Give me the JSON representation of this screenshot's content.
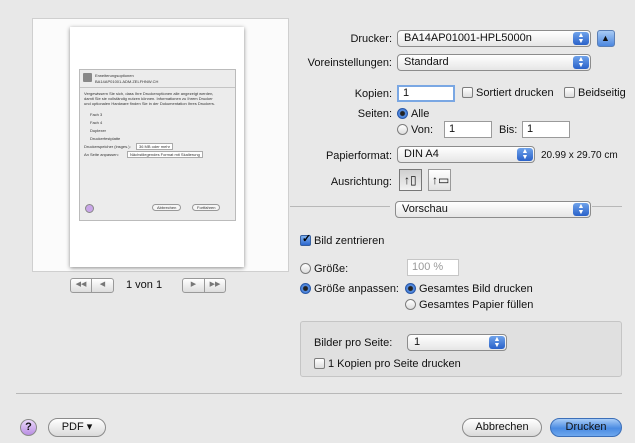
{
  "printer": {
    "label": "Drucker:",
    "value": "BA14AP01001-HPL5000n"
  },
  "presets": {
    "label": "Voreinstellungen:",
    "value": "Standard"
  },
  "copies": {
    "label": "Kopien:",
    "value": "1",
    "collated": "Sortiert drucken",
    "duplex": "Beidseitig"
  },
  "pages": {
    "label": "Seiten:",
    "all": "Alle",
    "from": "Von:",
    "from_value": "1",
    "to": "Bis:",
    "to_value": "1"
  },
  "paper": {
    "label": "Papierformat:",
    "value": "DIN A4",
    "size": "20.99 x 29.70 cm"
  },
  "orientation": {
    "label": "Ausrichtung:"
  },
  "panel": {
    "value": "Vorschau"
  },
  "center_image": "Bild zentrieren",
  "size": {
    "label": "Größe:",
    "value": "100 %"
  },
  "fit": {
    "label": "Größe anpassen:",
    "whole_image": "Gesamtes Bild drucken",
    "whole_paper": "Gesamtes Papier füllen"
  },
  "images_per_page": {
    "label": "Bilder pro Seite:",
    "value": "1",
    "copies_per_page": "1 Kopien pro Seite drucken"
  },
  "pager": {
    "text": "1 von 1"
  },
  "buttons": {
    "help": "?",
    "pdf": "PDF ▾",
    "cancel": "Abbrechen",
    "print": "Drucken"
  },
  "preview_doc": {
    "title": "Erweiterungsoptionen",
    "subtitle": "BA14AP01001.ADM.ZELFHNW.CH",
    "text1": "Vergewissern Sie sich, dass Ihre Druckeroptionen alle angezeigt werden,",
    "text2": "damit Sie sie vollständig nutzen können. Informationen zu Ihrem Drucker",
    "text3": "und optionalen Hardware finden Sie in der Dokumentation Ihres Druckers.",
    "opt1": "Fach 3",
    "opt2": "Fach 4",
    "opt3": "Duplexer",
    "opt4": "Druckerfestplatte",
    "mem_label": "Druckerspeicher (insges.):",
    "mem_value": "36 MB oder mehr",
    "fit_label": "An Seite anpassen:",
    "fit_value": "Nächstliegendes Format mit Skalierung",
    "btn_cancel": "Abbrechen",
    "btn_continue": "Fortfahren"
  }
}
